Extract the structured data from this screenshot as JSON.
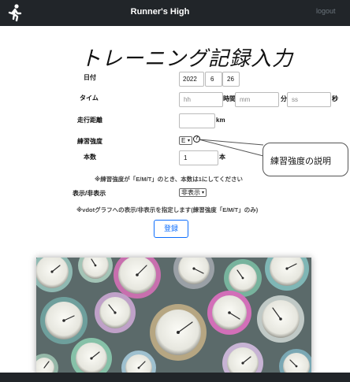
{
  "navbar": {
    "brand": "Runner's High",
    "logout": "logout",
    "icon": "runner-icon"
  },
  "page": {
    "title": "トレーニング記録入力"
  },
  "form": {
    "date": {
      "label": "日付",
      "year": "2022",
      "month": "6",
      "day": "26"
    },
    "time": {
      "label": "タイム",
      "hours_placeholder": "hh",
      "hours_unit": "時間",
      "minutes_placeholder": "mm",
      "minutes_unit": "分",
      "seconds_placeholder": "ss",
      "seconds_unit": "秒"
    },
    "distance": {
      "label": "走行距離",
      "value": "",
      "unit": "km"
    },
    "intensity": {
      "label": "練習強度",
      "selected": "E"
    },
    "count": {
      "label": "本数",
      "value": "1",
      "unit": "本"
    },
    "count_note": "※練習強度が「E/M/T」のとき、本数は1にしてください",
    "visibility": {
      "label": "表示/非表示",
      "selected": "非表示"
    },
    "visibility_note": "※vdotグラフへの表示/非表示を指定します(練習強度「E/M/T」のみ)",
    "submit": "登録"
  },
  "callout": {
    "text": "練習強度の説明"
  },
  "photo": {
    "subject": "stopwatches-image"
  },
  "colors": {
    "navbar": "#212529",
    "accent": "#0d6efd"
  }
}
